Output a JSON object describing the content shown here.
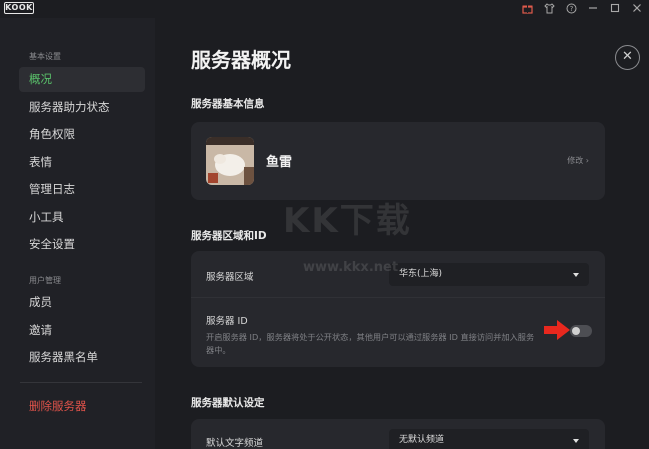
{
  "app": {
    "logo_text": "KOOK"
  },
  "titlebar": {
    "icons": [
      "gift-icon",
      "shirt-icon",
      "help-icon",
      "minimize-icon",
      "maximize-icon",
      "close-icon"
    ]
  },
  "sidebar": {
    "section1_label": "基本设置",
    "items1": [
      {
        "label": "概况",
        "active": true
      },
      {
        "label": "服务器助力状态"
      },
      {
        "label": "角色权限"
      },
      {
        "label": "表情"
      },
      {
        "label": "管理日志"
      },
      {
        "label": "小工具"
      },
      {
        "label": "安全设置"
      }
    ],
    "section2_label": "用户管理",
    "items2": [
      {
        "label": "成员"
      },
      {
        "label": "邀请"
      },
      {
        "label": "服务器黑名单"
      }
    ],
    "delete_label": "删除服务器"
  },
  "main": {
    "title": "服务器概况",
    "basic_info": {
      "section_title": "服务器基本信息",
      "server_name": "鱼雷",
      "edit_label": "修改 ›"
    },
    "region": {
      "section_title": "服务器区域和ID",
      "region_label": "服务器区域",
      "region_value": "华东(上海)",
      "id_label": "服务器 ID",
      "id_desc": "开启服务器 ID，服务器将处于公开状态，其他用户可以通过服务器 ID 直接访问并加入服务器中。",
      "id_enabled": false
    },
    "defaults": {
      "section_title": "服务器默认设定",
      "text_channel_label": "默认文字频道",
      "text_channel_value": "无默认频道"
    }
  },
  "watermark": {
    "big": "KK下载",
    "small": "www.kkx.net"
  },
  "colors": {
    "accent_green": "#5ac26b",
    "danger_red": "#e0534a",
    "arrow_red": "#e8281e"
  }
}
